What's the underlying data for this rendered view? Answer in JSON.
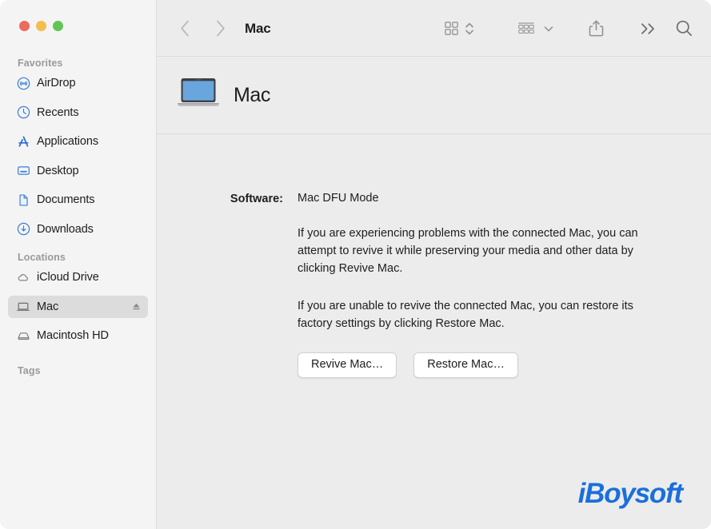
{
  "window": {
    "traffic_lights": [
      {
        "name": "close",
        "color": "#ed6a5e"
      },
      {
        "name": "minimize",
        "color": "#f4bd4f"
      },
      {
        "name": "zoom",
        "color": "#61c554"
      }
    ]
  },
  "toolbar": {
    "back_icon": "chevron-left-icon",
    "forward_icon": "chevron-right-icon",
    "title": "Mac",
    "view_icon": "grid-view-icon",
    "view_stepper_icon": "chevron-up-down-icon",
    "group_icon": "group-by-icon",
    "group_chevron_icon": "chevron-down-icon",
    "share_icon": "share-icon",
    "more_icon": "double-chevron-right-icon",
    "search_icon": "search-icon"
  },
  "sidebar": {
    "sections": [
      {
        "title": "Favorites",
        "items": [
          {
            "label": "AirDrop",
            "icon": "airdrop-icon",
            "selected": false,
            "eject": false
          },
          {
            "label": "Recents",
            "icon": "clock-icon",
            "selected": false,
            "eject": false
          },
          {
            "label": "Applications",
            "icon": "applications-icon",
            "selected": false,
            "eject": false
          },
          {
            "label": "Desktop",
            "icon": "desktop-icon",
            "selected": false,
            "eject": false
          },
          {
            "label": "Documents",
            "icon": "document-icon",
            "selected": false,
            "eject": false
          },
          {
            "label": "Downloads",
            "icon": "downloads-icon",
            "selected": false,
            "eject": false
          }
        ]
      },
      {
        "title": "Locations",
        "items": [
          {
            "label": "iCloud Drive",
            "icon": "cloud-icon",
            "selected": false,
            "eject": false
          },
          {
            "label": "Mac",
            "icon": "laptop-icon",
            "selected": true,
            "eject": true
          },
          {
            "label": "Macintosh HD",
            "icon": "harddisk-icon",
            "selected": false,
            "eject": false
          }
        ]
      },
      {
        "title": "Tags",
        "items": []
      }
    ]
  },
  "device_header": {
    "icon": "macbook-icon",
    "name": "Mac"
  },
  "info": {
    "label": "Software:",
    "value": "Mac DFU Mode",
    "paragraphs": [
      "If you are experiencing problems with the connected Mac, you can attempt to revive it while preserving your media and other data by clicking Revive Mac.",
      "If you are unable to revive the connected Mac, you can restore its factory settings by clicking Restore Mac."
    ],
    "buttons": [
      {
        "label": "Revive Mac…"
      },
      {
        "label": "Restore Mac…"
      }
    ]
  },
  "watermark": {
    "text": "iBoysoft",
    "color": "#1a6fdb"
  }
}
